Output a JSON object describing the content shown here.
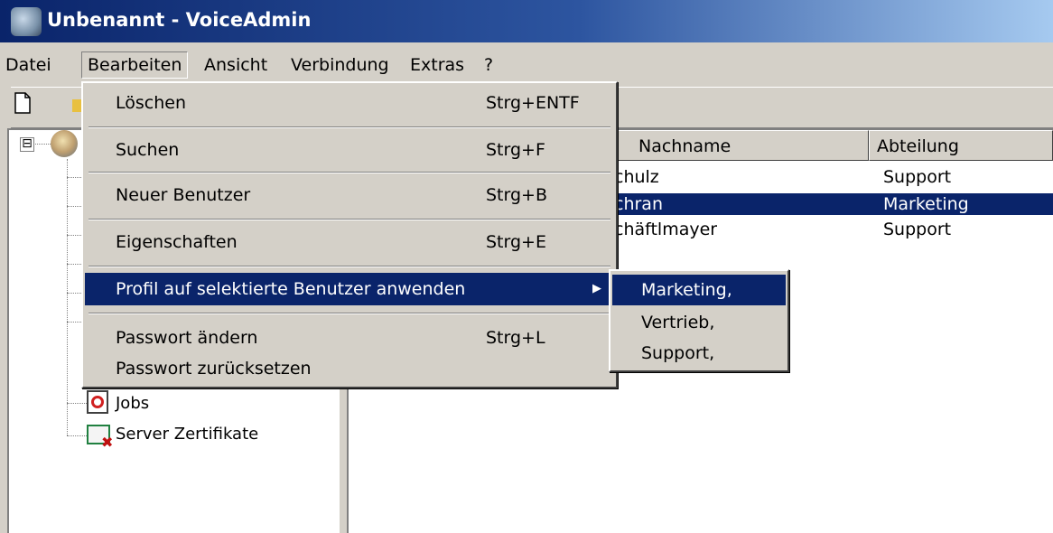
{
  "window": {
    "title": "Unbenannt - VoiceAdmin",
    "icon": "voiceadmin-app-icon"
  },
  "menubar": {
    "items": [
      {
        "label": "Datei"
      },
      {
        "label": "Bearbeiten",
        "open": true
      },
      {
        "label": "Ansicht"
      },
      {
        "label": "Verbindung"
      },
      {
        "label": "Extras"
      },
      {
        "label": "?"
      }
    ]
  },
  "toolbar": {
    "icons": [
      "new-document-icon",
      "open-folder-icon"
    ]
  },
  "edit_menu": {
    "items": [
      {
        "label": "Löschen",
        "shortcut": "Strg+ENTF"
      },
      {
        "label": "Suchen",
        "shortcut": "Strg+F"
      },
      {
        "label": "Neuer Benutzer",
        "shortcut": "Strg+B"
      },
      {
        "label": "Eigenschaften",
        "shortcut": "Strg+E"
      },
      {
        "label": "Profil auf selektierte Benutzer anwenden",
        "shortcut": "",
        "submenu": true,
        "highlighted": true
      },
      {
        "label": "Passwort ändern",
        "shortcut": "Strg+L"
      },
      {
        "label": "Passwort zurücksetzen",
        "shortcut": ""
      }
    ]
  },
  "profile_submenu": {
    "items": [
      {
        "label": "Marketing,",
        "highlighted": true
      },
      {
        "label": "Vertrieb,"
      },
      {
        "label": "Support,"
      }
    ]
  },
  "tree": {
    "expander": "⊟",
    "items": [
      {
        "label": "Jobs",
        "icon": "jobs-icon"
      },
      {
        "label": "Server Zertifikate",
        "icon": "certificate-icon"
      }
    ]
  },
  "list": {
    "columns": [
      {
        "label": "Nachname"
      },
      {
        "label": "Abteilung"
      }
    ],
    "rows": [
      {
        "nachname": "chulz",
        "abteilung": "Support",
        "selected": false
      },
      {
        "nachname": "chran",
        "abteilung": "Marketing",
        "selected": true
      },
      {
        "nachname": "chäftlmayer",
        "abteilung": "Support",
        "selected": false
      }
    ]
  },
  "colors": {
    "title_gradient_start": "#0a246a",
    "title_gradient_end": "#a6caf0",
    "selection": "#0a246a",
    "face": "#d4d0c8"
  }
}
